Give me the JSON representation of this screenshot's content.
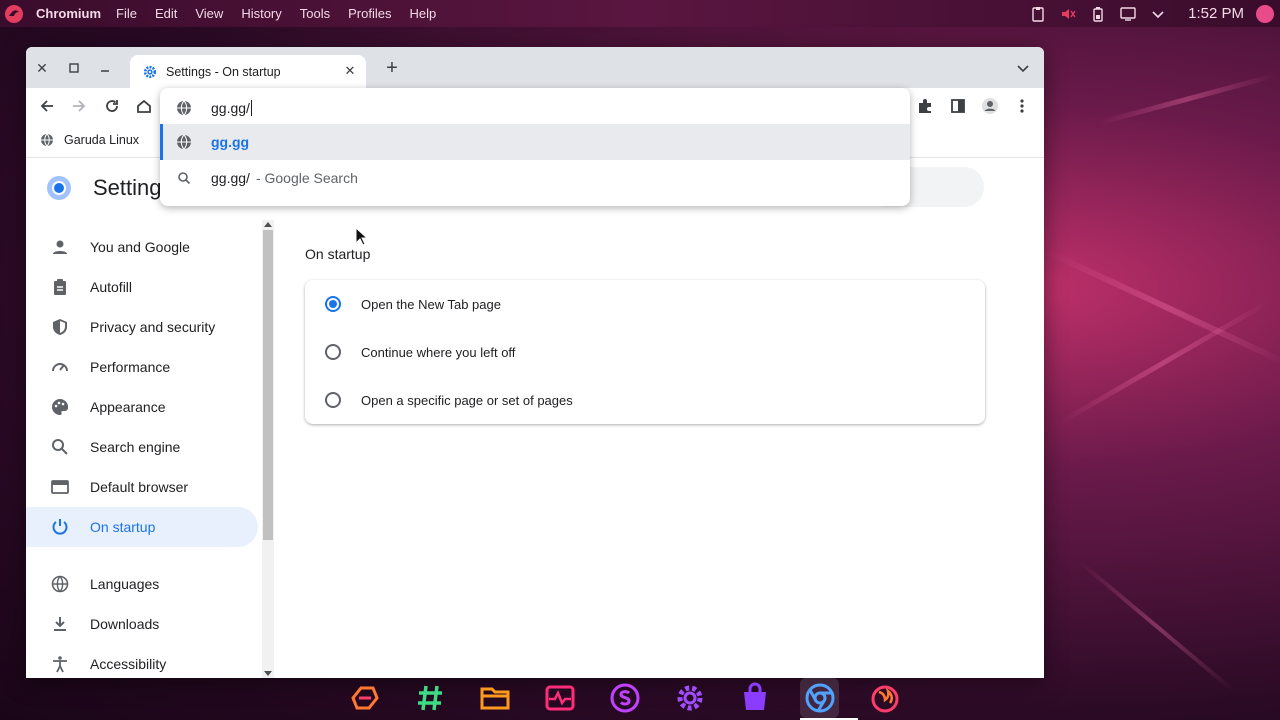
{
  "top_panel": {
    "app_name": "Chromium",
    "menu": [
      "File",
      "Edit",
      "View",
      "History",
      "Tools",
      "Profiles",
      "Help"
    ],
    "clock": "1:52 PM"
  },
  "browser": {
    "tab_title": "Settings - On startup",
    "omnibox_text": "gg.gg/",
    "suggestions": [
      {
        "text": "gg.gg",
        "desc": "",
        "icon": "globe-icon"
      },
      {
        "text": "gg.gg/",
        "desc": "- Google Search",
        "icon": "search-icon"
      }
    ],
    "bookmarks": [
      {
        "label": "Garuda Linux",
        "icon": "globe-icon"
      }
    ]
  },
  "settings": {
    "title": "Settings",
    "sidebar": [
      {
        "label": "You and Google",
        "icon": "person-icon",
        "active": false
      },
      {
        "label": "Autofill",
        "icon": "clipboard-icon",
        "active": false
      },
      {
        "label": "Privacy and security",
        "icon": "shield-icon",
        "active": false
      },
      {
        "label": "Performance",
        "icon": "gauge-icon",
        "active": false
      },
      {
        "label": "Appearance",
        "icon": "palette-icon",
        "active": false
      },
      {
        "label": "Search engine",
        "icon": "search-icon",
        "active": false
      },
      {
        "label": "Default browser",
        "icon": "browser-icon",
        "active": false
      },
      {
        "label": "On startup",
        "icon": "power-icon",
        "active": true
      },
      {
        "label": "Languages",
        "icon": "globe-icon",
        "active": false
      },
      {
        "label": "Downloads",
        "icon": "download-icon",
        "active": false
      },
      {
        "label": "Accessibility",
        "icon": "accessibility-icon",
        "active": false
      }
    ],
    "section_title": "On startup",
    "options": [
      {
        "label": "Open the New Tab page",
        "checked": true
      },
      {
        "label": "Continue where you left off",
        "checked": false
      },
      {
        "label": "Open a specific page or set of pages",
        "checked": false
      }
    ]
  },
  "colors": {
    "accent": "#1a73e8",
    "active_bg": "#e8f0fe"
  },
  "dock": [
    "garuda-icon",
    "hashtag-icon",
    "files-icon",
    "activity-icon",
    "s-app-icon",
    "settings-gear-icon",
    "store-bag-icon",
    "chromium-icon",
    "firedragon-icon"
  ]
}
